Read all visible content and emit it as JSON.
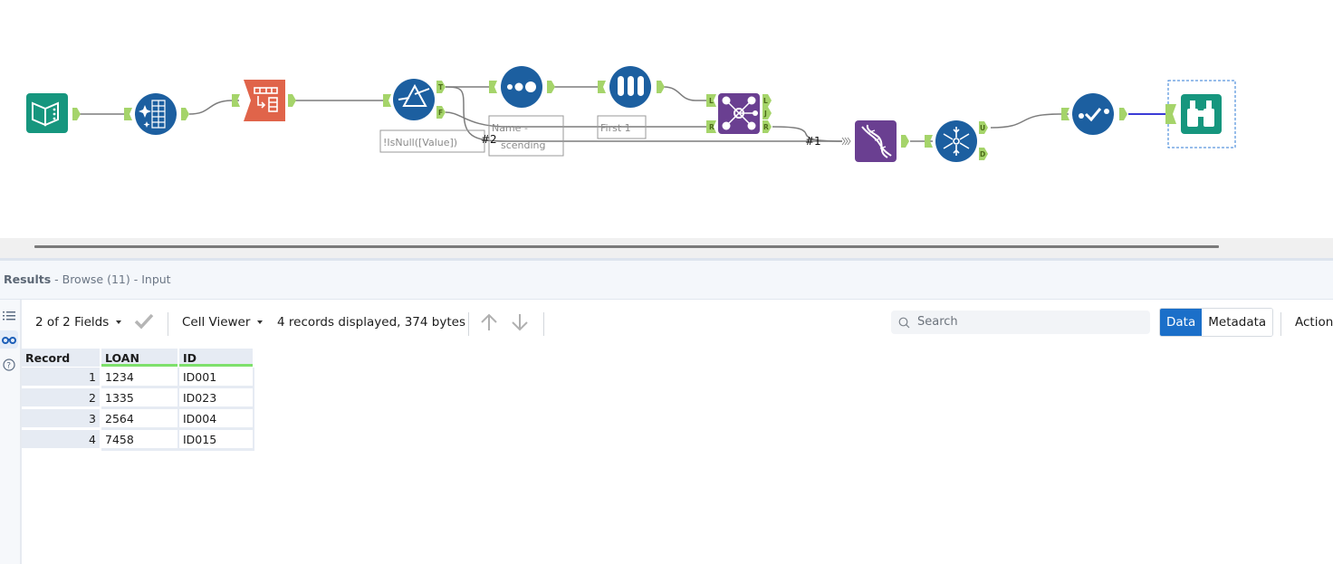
{
  "canvas": {
    "tools": [
      {
        "id": "input",
        "name": "Input Data",
        "icon": "book-icon",
        "color": "#16967e"
      },
      {
        "id": "data-cleansing",
        "name": "Data Cleansing",
        "icon": "sparkle-grid-icon",
        "color": "#1c5fa0"
      },
      {
        "id": "text-to-columns",
        "name": "Text To Columns",
        "icon": "split-columns-icon",
        "color": "#e0644a"
      },
      {
        "id": "filter",
        "name": "Filter",
        "icon": "prism-icon",
        "color": "#1c5fa0",
        "annotation": "!IsNull([Value])",
        "outputs": [
          "T",
          "F"
        ]
      },
      {
        "id": "sort",
        "name": "Sort",
        "icon": "dots-icon",
        "color": "#1c5fa0",
        "annotation": "Name - Ascending"
      },
      {
        "id": "sample",
        "name": "Sample",
        "icon": "test-tubes-icon",
        "color": "#1c5fa0",
        "annotation": "First 1"
      },
      {
        "id": "join",
        "name": "Join",
        "icon": "network-icon",
        "color": "#6a3f91",
        "inputs": [
          "L",
          "R"
        ],
        "outputs": [
          "L",
          "J",
          "R"
        ]
      },
      {
        "id": "union",
        "name": "Union",
        "icon": "dna-icon",
        "color": "#6a3f91"
      },
      {
        "id": "unique",
        "name": "Unique",
        "icon": "snowflake-icon",
        "color": "#1c5fa0",
        "outputs": [
          "U",
          "D"
        ]
      },
      {
        "id": "select",
        "name": "Select",
        "icon": "check-dots-icon",
        "color": "#1c5fa0"
      },
      {
        "id": "browse",
        "name": "Browse",
        "icon": "binoculars-icon",
        "color": "#16967e",
        "selected": true
      }
    ],
    "annotations": {
      "filter": "!IsNull([Value])",
      "sort_line1": "Name -",
      "sort_line2": "scending",
      "sample": "First 1"
    },
    "connection_labels": {
      "c2": "#2",
      "c1": "#1"
    },
    "ports": {
      "filter_true": "T",
      "filter_false": "F",
      "join_in_left": "L",
      "join_in_right": "R",
      "join_out_left": "L",
      "join_out_join": "J",
      "join_out_right": "R",
      "unique_out_unique": "U",
      "unique_out_dup": "D"
    }
  },
  "results": {
    "title": "Results",
    "subtitle": " - Browse (11) - Input",
    "rail": [
      {
        "icon": "list-icon",
        "active": false
      },
      {
        "icon": "binoculars-icon",
        "active": true
      },
      {
        "icon": "help-icon",
        "active": false
      }
    ],
    "toolbar": {
      "fields_label": "2 of 2 Fields",
      "cell_viewer_label": "Cell Viewer",
      "records_info": "4 records displayed, 374 bytes",
      "search_placeholder": "Search",
      "data_tab": "Data",
      "metadata_tab": "Metadata",
      "actions_label": "Actions",
      "active_tab": "Data",
      "accent_color": "#1b6fc9"
    },
    "table": {
      "columns": [
        "Record",
        "LOAN",
        "ID"
      ],
      "rows": [
        {
          "record": "1",
          "loan": "1234",
          "id": "ID001"
        },
        {
          "record": "2",
          "loan": "1335",
          "id": "ID023"
        },
        {
          "record": "3",
          "loan": "2564",
          "id": "ID004"
        },
        {
          "record": "4",
          "loan": "7458",
          "id": "ID015"
        }
      ]
    }
  }
}
